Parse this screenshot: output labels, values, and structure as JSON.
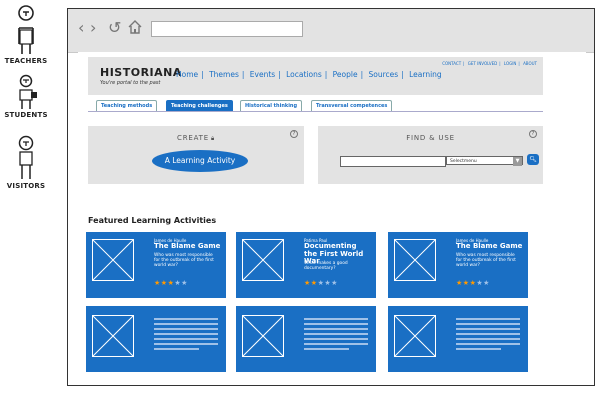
{
  "personas": [
    {
      "label": "TEACHERS"
    },
    {
      "label": "STUDENTS"
    },
    {
      "label": "VISITORS"
    }
  ],
  "browser": {
    "nav_icons": [
      "back-icon",
      "forward-icon",
      "refresh-icon",
      "home-icon"
    ],
    "address_value": ""
  },
  "header": {
    "logo": "HISTORIANA",
    "tagline": "You're portal to the past",
    "nav": [
      "Home",
      "Themes",
      "Events",
      "Locations",
      "People",
      "Sources",
      "Learning"
    ],
    "utility_nav": [
      "CONTACT",
      "GET INVOLVED",
      "LOGIN",
      "ABOUT"
    ]
  },
  "tabs": [
    {
      "label": "Teaching methods",
      "active": false
    },
    {
      "label": "Teaching challenges",
      "active": true
    },
    {
      "label": "Historical thinking",
      "active": false
    },
    {
      "label": "Transversal competences",
      "active": false
    }
  ],
  "create": {
    "title": "CREATE",
    "button_label": "A Learning Activity"
  },
  "find": {
    "title": "FIND & USE",
    "search_value": "",
    "select_value": "Selectmenu",
    "go_icon": "search-icon"
  },
  "featured": {
    "title": "Featured Learning Activities",
    "cards": [
      {
        "author": "James de Haulle",
        "title": "The Blame Game",
        "desc": "Who was most responsible for the outbreak of the first world war?",
        "rating": 3,
        "max": 5
      },
      {
        "author": "Patima Paul",
        "title": "Documenting the First World War",
        "desc": "What makes a good documentary?",
        "rating": 2,
        "max": 5
      },
      {
        "author": "James de Haulle",
        "title": "The Blame Game",
        "desc": "Who was most responsible for the outbreak of the first world war?",
        "rating": 3,
        "max": 5
      }
    ]
  },
  "colors": {
    "accent": "#1a6fc4",
    "panel": "#e3e3e3",
    "star": "#ff9900"
  }
}
